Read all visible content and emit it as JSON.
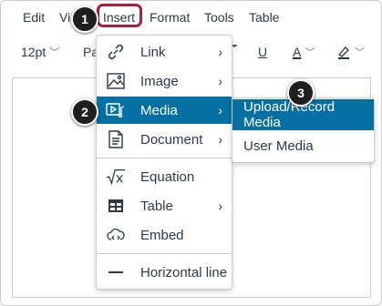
{
  "menubar": {
    "items": [
      "Edit",
      "Vi",
      "Insert",
      "Format",
      "Tools",
      "Table"
    ]
  },
  "toolbar": {
    "font_size": "12pt",
    "paragraph": "Pa",
    "underline_glyph": "U",
    "text_color_glyph": "A"
  },
  "insert_menu": {
    "items": [
      {
        "label": "Link",
        "icon": "link-icon",
        "submenu": true
      },
      {
        "label": "Image",
        "icon": "image-icon",
        "submenu": true
      },
      {
        "label": "Media",
        "icon": "media-icon",
        "submenu": true,
        "active": true
      },
      {
        "label": "Document",
        "icon": "document-icon",
        "submenu": true
      },
      {
        "label": "Equation",
        "icon": "equation-icon",
        "submenu": false
      },
      {
        "label": "Table",
        "icon": "table-icon",
        "submenu": true
      },
      {
        "label": "Embed",
        "icon": "embed-icon",
        "submenu": false
      },
      {
        "label": "Horizontal line",
        "icon": "horizontal-line-icon",
        "submenu": false
      }
    ],
    "arrow": "›"
  },
  "media_submenu": {
    "items": [
      {
        "label": "Upload/Record Media",
        "active": true
      },
      {
        "label": "User Media",
        "active": false
      }
    ]
  },
  "steps": [
    "1",
    "2",
    "3"
  ],
  "colors": {
    "highlight": "#a8213b",
    "active": "#0770a3",
    "text": "#2d3b45",
    "badge": "#1f1f1f"
  }
}
